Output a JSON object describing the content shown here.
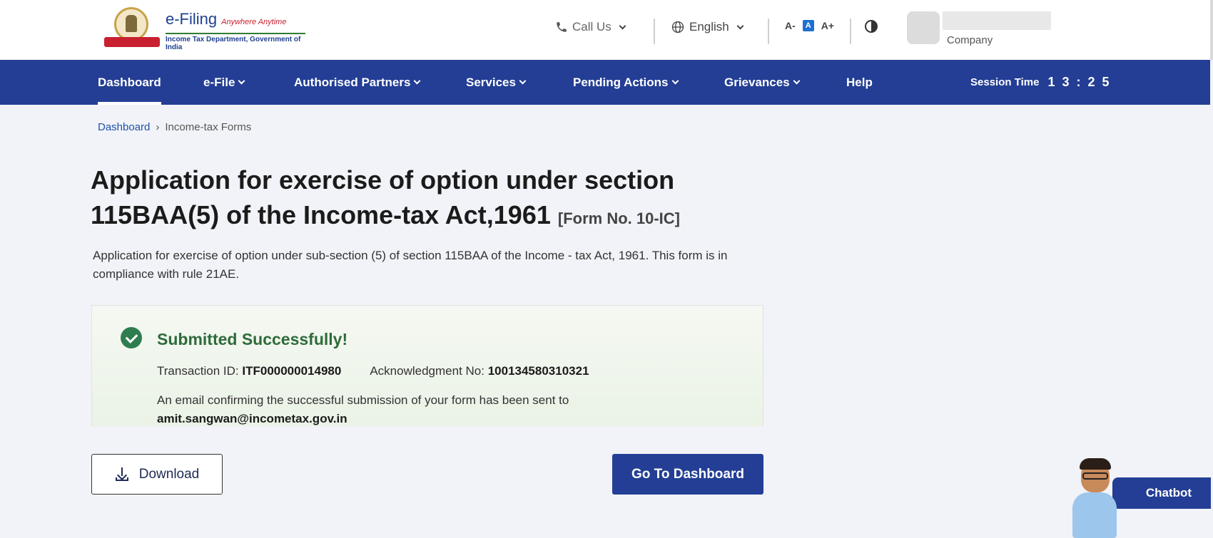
{
  "header": {
    "logo_title": "e-Filing",
    "logo_tagline": "Anywhere Anytime",
    "logo_subtitle": "Income Tax Department, Government of India",
    "call_us": "Call Us",
    "language": "English",
    "font_smaller": "A-",
    "font_default": "A",
    "font_larger": "A+",
    "user_role": "Company"
  },
  "nav": {
    "items": [
      {
        "label": "Dashboard"
      },
      {
        "label": "e-File"
      },
      {
        "label": "Authorised Partners"
      },
      {
        "label": "Services"
      },
      {
        "label": "Pending Actions"
      },
      {
        "label": "Grievances"
      },
      {
        "label": "Help"
      }
    ],
    "session_label": "Session Time",
    "session_value": "13:25"
  },
  "breadcrumb": {
    "home": "Dashboard",
    "separator": "›",
    "current": "Income-tax Forms"
  },
  "page": {
    "title": "Application for exercise of option under section 115BAA(5) of the Income-tax Act,1961",
    "form_no": "[Form No. 10-IC]",
    "description": "Application for exercise of option under sub-section (5) of section 115BAA of the Income - tax Act, 1961. This form is in compliance with rule 21AE."
  },
  "success": {
    "title": "Submitted Successfully!",
    "txn_label": "Transaction ID:",
    "txn_value": "ITF000000014980",
    "ack_label": "Acknowledgment No:",
    "ack_value": "100134580310321",
    "email_note": "An email confirming the successful submission of your form has been sent to",
    "email": "amit.sangwan@incometax.gov.in"
  },
  "actions": {
    "download": "Download",
    "go_dashboard": "Go To Dashboard"
  },
  "chatbot": {
    "label": "Chatbot"
  },
  "colors": {
    "primary": "#233e94",
    "success": "#2e7d4f",
    "background": "#f1f3f8"
  }
}
